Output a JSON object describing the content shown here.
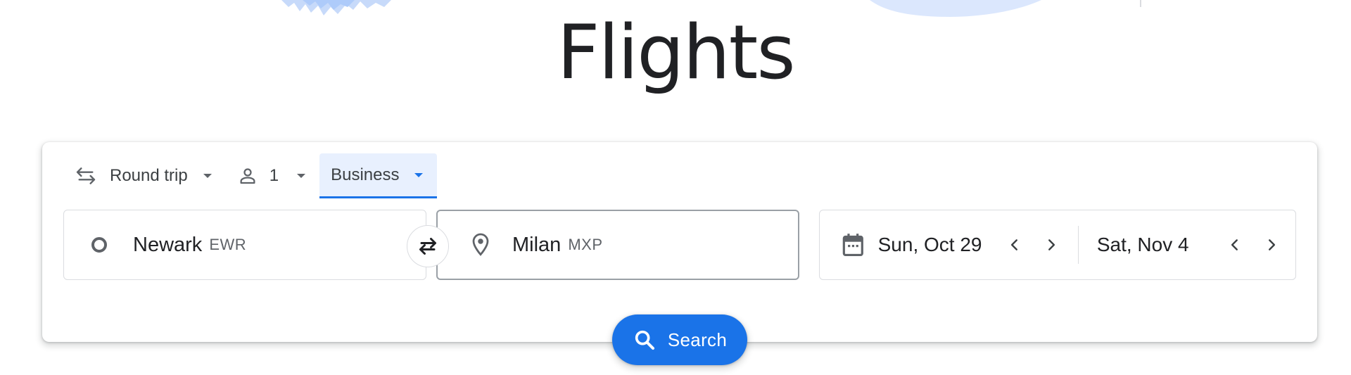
{
  "page": {
    "title": "Flights"
  },
  "trip_options": {
    "trip_type": {
      "label": "Round trip",
      "icon": "swap-arrows-icon"
    },
    "passengers": {
      "count": "1",
      "icon": "person-icon"
    },
    "cabin_class": {
      "label": "Business",
      "selected": true
    }
  },
  "origin": {
    "place": "Newark",
    "code": "EWR",
    "icon": "circle-icon"
  },
  "destination": {
    "place": "Milan",
    "code": "MXP",
    "icon": "location-pin-icon"
  },
  "swap_button": {
    "icon": "swap-icon"
  },
  "dates": {
    "departure": "Sun, Oct 29",
    "return": "Sat, Nov 4",
    "icon": "calendar-icon"
  },
  "search_button": {
    "label": "Search",
    "icon": "search-icon"
  },
  "colors": {
    "accent": "#1a73e8",
    "selected_bg": "#e8f0fe",
    "text": "#202124",
    "muted": "#5f6368",
    "border": "#dadce0"
  }
}
